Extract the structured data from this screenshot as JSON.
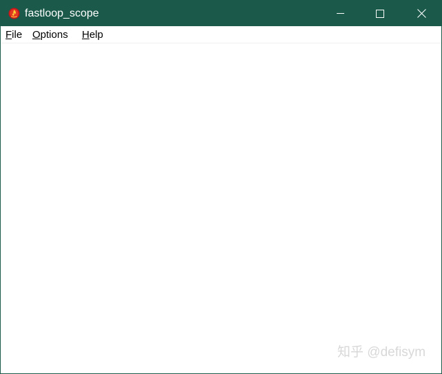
{
  "window": {
    "title": "fastloop_scope",
    "titlebar_color": "#1b5a4a",
    "app_icon": "red-flame-orb-icon",
    "controls": {
      "minimize_icon": "minimize-icon",
      "maximize_icon": "maximize-icon",
      "close_icon": "close-icon"
    }
  },
  "menubar": {
    "items": [
      {
        "mnemonic": "F",
        "rest": "ile"
      },
      {
        "mnemonic": "O",
        "rest": "ptions"
      },
      {
        "mnemonic": "H",
        "rest": "elp"
      }
    ]
  },
  "watermark": {
    "text": "知乎 @defisym"
  }
}
